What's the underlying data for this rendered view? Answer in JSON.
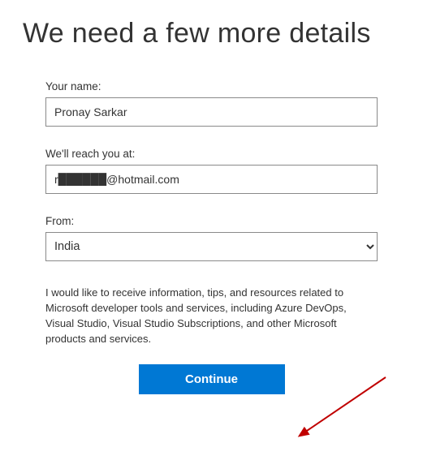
{
  "page": {
    "title": "We need a few more details"
  },
  "form": {
    "name": {
      "label": "Your name:",
      "value": "Pronay Sarkar"
    },
    "email": {
      "label": "We'll reach you at:",
      "value": "r██████@hotmail.com"
    },
    "country": {
      "label": "From:",
      "selected": "India"
    },
    "consent_text": "I would like to receive information, tips, and resources related to Microsoft developer tools and services, including Azure DevOps, Visual Studio, Visual Studio Subscriptions, and other Microsoft products and services.",
    "continue_label": "Continue"
  },
  "colors": {
    "primary": "#0078d4",
    "arrow": "#c00000"
  }
}
